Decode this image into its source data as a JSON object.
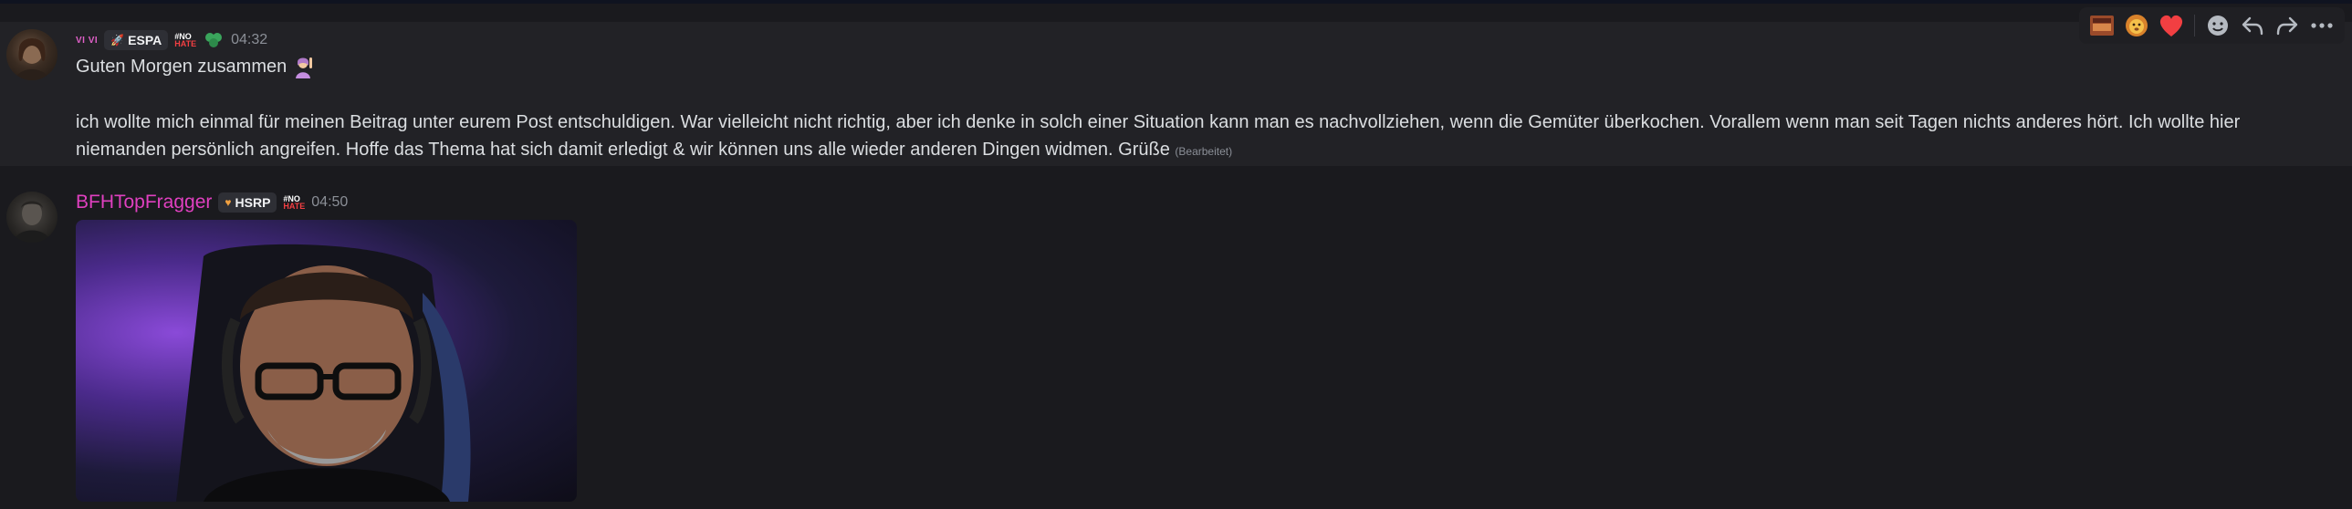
{
  "messages": [
    {
      "author": "VI VI",
      "tag": "ESPA",
      "badge_lines": [
        "#NO",
        "HATE"
      ],
      "time": "04:32",
      "greeting": "Guten Morgen zusammen",
      "body": "ich wollte mich einmal für meinen Beitrag unter eurem Post entschuldigen. War vielleicht nicht richtig, aber ich denke in solch einer Situation kann man es nachvollziehen, wenn die Gemüter überkochen. Vorallem wenn man seit Tagen nichts anderes hört. Ich wollte hier niemanden persönlich angreifen. Hoffe das Thema hat sich damit erledigt & wir können uns alle wieder anderen Dingen widmen. Grüße",
      "edited_label": "(Bearbeitet)"
    },
    {
      "author": "BFHTopFragger",
      "tag": "HSRP",
      "badge_lines": [
        "#NO",
        "HATE"
      ],
      "time": "04:50",
      "attachment": "gif"
    }
  ],
  "toolbar": {
    "icons": [
      "reaction-photo-icon",
      "lion-emoji-icon",
      "heart-emoji-icon",
      "add-reaction-icon",
      "reply-icon",
      "forward-icon",
      "more-icon"
    ]
  },
  "colors": {
    "background": "#1a1a1e",
    "highlight_row": "#222226",
    "author_pink": "#e040c0",
    "heart": "#f23f42"
  }
}
